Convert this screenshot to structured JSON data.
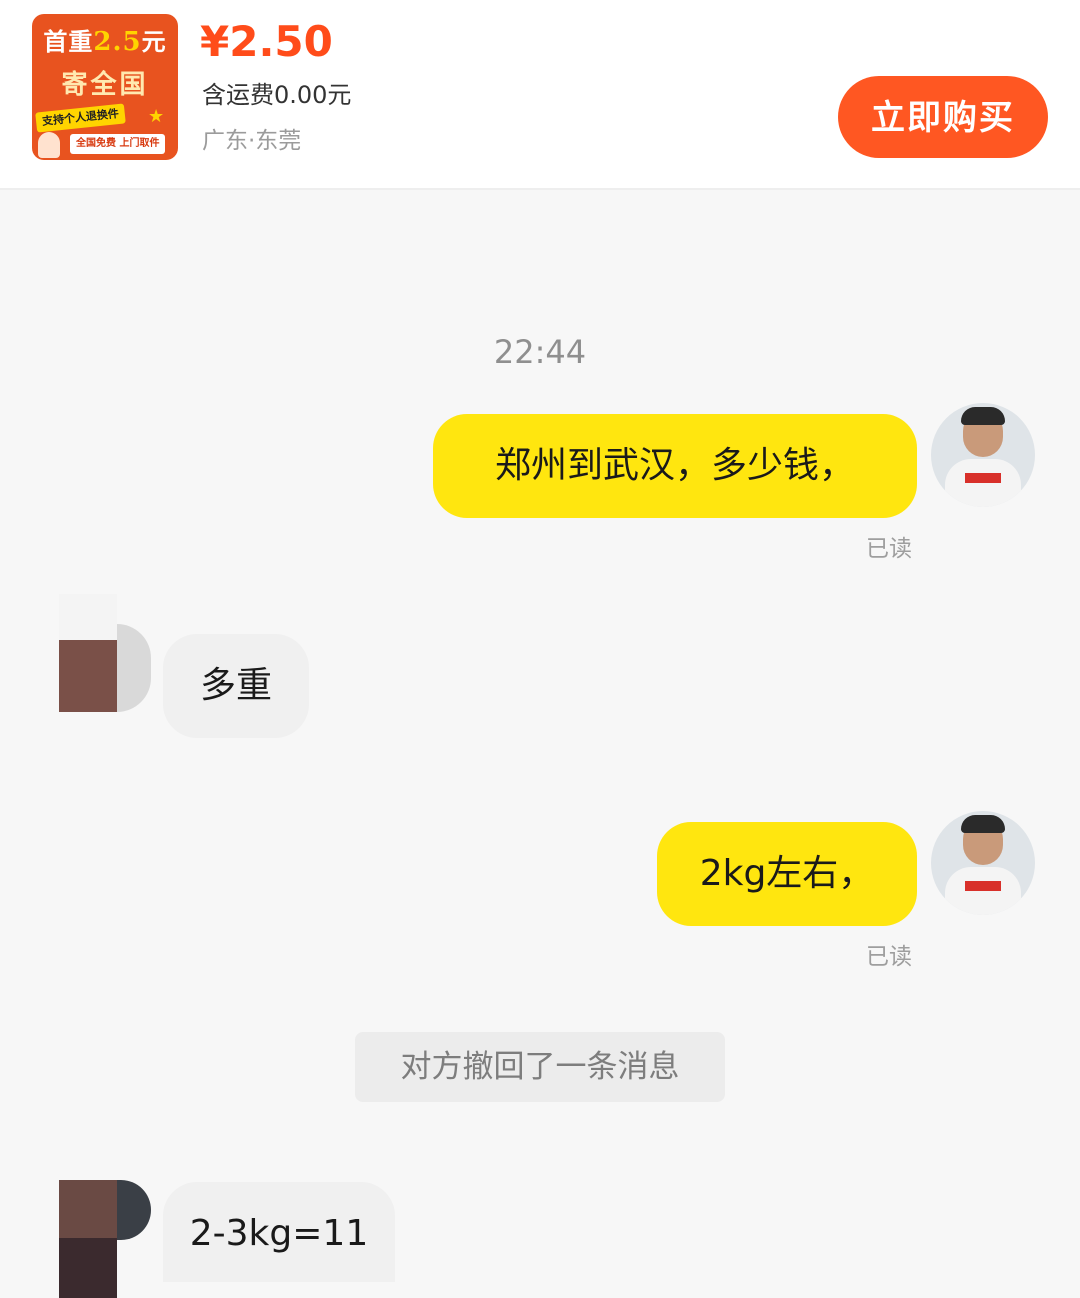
{
  "product": {
    "thumbnail": {
      "line1_a": "首重",
      "line1_b": "2.5",
      "line1_c": "元",
      "line2": "寄全国",
      "tag1": "支持个人退换件",
      "tag2": "全国免费 上门取件",
      "bg_color": "#e8531f"
    },
    "price": "¥2.50",
    "shipping": "含运费0.00元",
    "location": "广东·东莞",
    "buy_label": "立即购买",
    "accent_color": "#ff5722"
  },
  "chat": {
    "timestamp": "22:44",
    "messages": [
      {
        "sender": "me",
        "text": "郑州到武汉，多少钱，",
        "status": "已读"
      },
      {
        "sender": "them",
        "text": "多重"
      },
      {
        "sender": "me",
        "text": "2kg左右，",
        "status": "已读"
      },
      {
        "sender": "system",
        "text": "对方撤回了一条消息"
      },
      {
        "sender": "them",
        "text": "2-3kg=11"
      }
    ],
    "my_bubble_color": "#ffe60f",
    "their_bubble_color": "#f0f0f0"
  }
}
